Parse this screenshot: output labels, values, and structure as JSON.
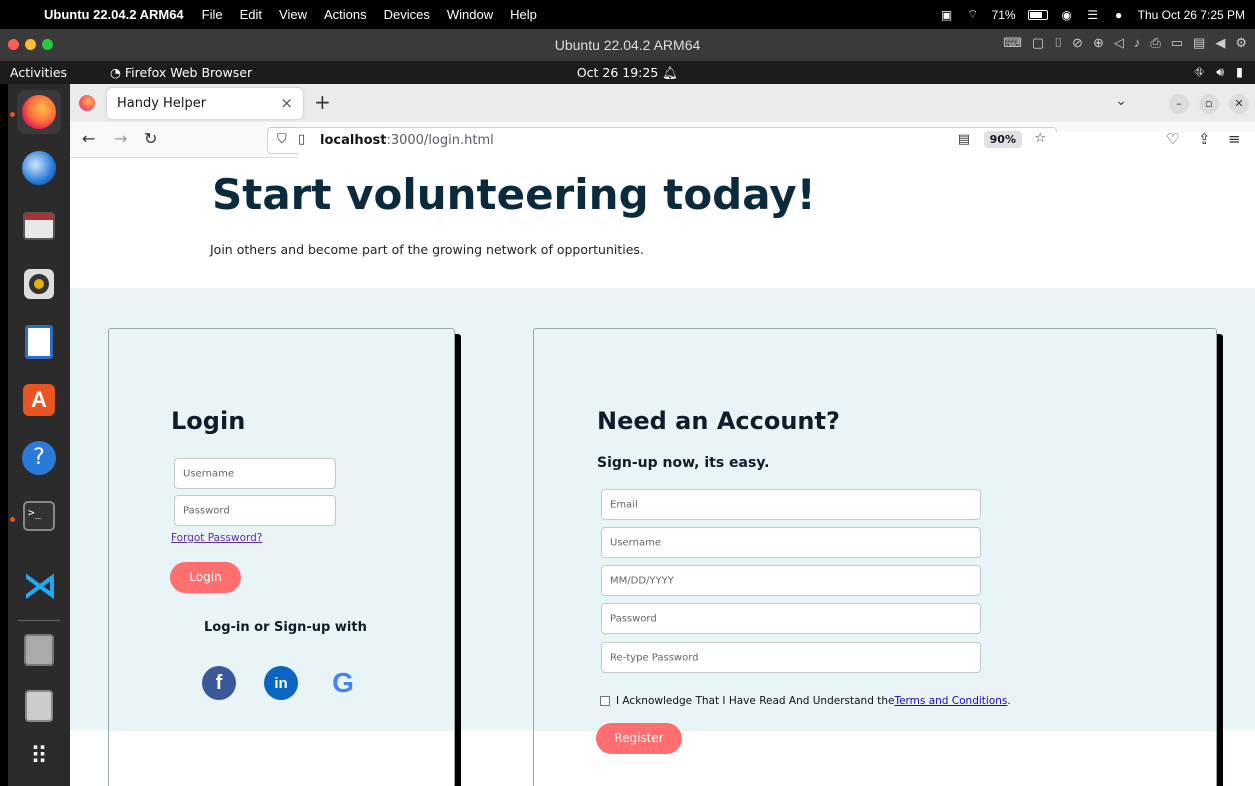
{
  "mac_menubar": {
    "app_name": "Ubuntu 22.04.2 ARM64",
    "menus": [
      "File",
      "Edit",
      "View",
      "Actions",
      "Devices",
      "Window",
      "Help"
    ],
    "battery": "71%",
    "datetime": "Thu Oct 26  7:25 PM"
  },
  "vm_window": {
    "title": "Ubuntu 22.04.2 ARM64"
  },
  "ubuntu_bar": {
    "activities": "Activities",
    "app_name": "Firefox Web Browser",
    "clock": "Oct 26  19:25"
  },
  "dock": {
    "items": [
      "firefox-icon",
      "thunderbird-icon",
      "files-icon",
      "rhythmbox-icon",
      "libreoffice-writer-icon",
      "app-center-icon",
      "help-icon",
      "terminal-icon",
      "vscode-icon",
      "drive-icon",
      "trash-icon",
      "show-apps-icon"
    ]
  },
  "browser": {
    "tab_title": "Handy Helper",
    "url_host": "localhost",
    "url_path": ":3000/login.html",
    "zoom": "90%"
  },
  "page": {
    "hero_title": "Start volunteering today!",
    "hero_subtitle": "Join others and become part of the growing network of opportunities.",
    "login": {
      "title": "Login",
      "username_placeholder": "Username",
      "password_placeholder": "Password",
      "forgot_link": "Forgot Password?",
      "login_button": "Login",
      "social_heading": "Log-in or Sign-up with"
    },
    "signup": {
      "title": "Need an Account?",
      "subtitle": "Sign-up now, its easy.",
      "email_placeholder": "Email",
      "username_placeholder": "Username",
      "dob_placeholder": "MM/DD/YYYY",
      "password_placeholder": "Password",
      "retype_placeholder": "Re-type Password",
      "terms_text": "I Acknowledge That I Have Read And Understand the ",
      "terms_link": "Terms and Conditions",
      "terms_end": ".",
      "register_button": "Register"
    }
  },
  "colors": {
    "accent": "#ff6f6f",
    "heading": "#0b2a3c",
    "band": "#e8f4f6"
  }
}
